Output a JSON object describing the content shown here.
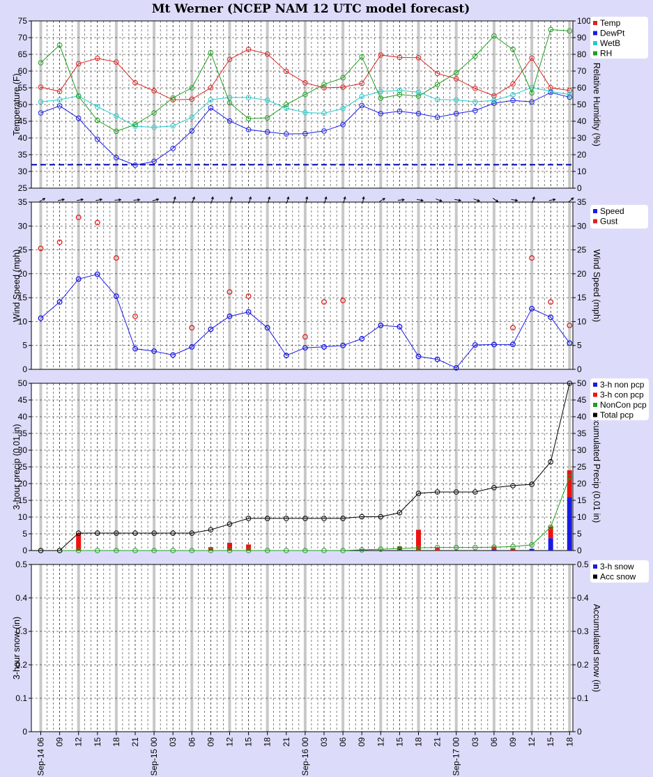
{
  "title": "Mt Werner (NCEP NAM 12 UTC model forecast)",
  "x_labels": [
    "Sep-14 06",
    "09",
    "12",
    "15",
    "18",
    "21",
    "Sep-15 00",
    "03",
    "06",
    "09",
    "12",
    "15",
    "18",
    "21",
    "Sep-16 00",
    "03",
    "06",
    "09",
    "12",
    "15",
    "18",
    "21",
    "Sep-17 00",
    "03",
    "06",
    "09",
    "12",
    "15",
    "18"
  ],
  "chart_data": [
    {
      "type": "line",
      "left_label": "Temperature (F)",
      "right_label": "Relative Humidity (%)",
      "ylim": [
        25,
        75
      ],
      "y_ticks": [
        25,
        30,
        35,
        40,
        45,
        50,
        55,
        60,
        65,
        70,
        75
      ],
      "y2lim": [
        0,
        100
      ],
      "y2_ticks": [
        0,
        10,
        20,
        30,
        40,
        50,
        60,
        70,
        80,
        90,
        100
      ],
      "legend": [
        {
          "name": "Temp",
          "color": "#dd2222"
        },
        {
          "name": "DewPt",
          "color": "#1a1ae6"
        },
        {
          "name": "WetB",
          "color": "#22cccc"
        },
        {
          "name": "RH",
          "color": "#1f9f1f"
        }
      ],
      "series": [
        {
          "name": "Temp",
          "color": "#dd2222",
          "axis": "left",
          "values": [
            55.2,
            53.9,
            62.2,
            63.8,
            62.7,
            56.5,
            54.1,
            51.4,
            51.6,
            55,
            63.5,
            66.5,
            65.1,
            59.9,
            56.5,
            55,
            55.2,
            56.3,
            64.8,
            64.1,
            64,
            59.3,
            57.7,
            54.8,
            52.6,
            56.1,
            63.9,
            55,
            54.2
          ]
        },
        {
          "name": "DewPt",
          "color": "#1a1ae6",
          "axis": "left",
          "values": [
            47.5,
            49.6,
            45.9,
            39.6,
            34.1,
            31.9,
            33,
            36.9,
            42.1,
            49,
            45.1,
            42.5,
            41.8,
            41.2,
            41.3,
            42.1,
            44,
            49.7,
            47.3,
            48,
            47.3,
            46.2,
            47.3,
            48.2,
            50.4,
            51.2,
            50.8,
            53.6,
            52.2
          ]
        },
        {
          "name": "WetB",
          "color": "#22cccc",
          "axis": "left",
          "values": [
            50.8,
            51.4,
            52.6,
            49.3,
            46.6,
            43.5,
            43.2,
            43.6,
            46.2,
            51.4,
            52.1,
            52.1,
            51.3,
            48.9,
            47.6,
            47.4,
            48.8,
            52.4,
            53.9,
            54.2,
            53.7,
            51.5,
            51.4,
            50.8,
            51.2,
            52.9,
            55.1,
            53.9,
            53
          ]
        },
        {
          "name": "RH",
          "color": "#1f9f1f",
          "axis": "right",
          "values": [
            75,
            85.5,
            55,
            40.5,
            34,
            38,
            45,
            54,
            60,
            81,
            51,
            41.6,
            42,
            50,
            56,
            62,
            66,
            78.5,
            53.7,
            56,
            55,
            62,
            69,
            79,
            91,
            83,
            57,
            94.8,
            94
          ]
        }
      ],
      "threshold_line": {
        "value": 32,
        "color": "#0000aa"
      }
    },
    {
      "type": "scatter",
      "left_label": "Wind Speed (mph)",
      "right_label": "Wind Speed (mph)",
      "ylim": [
        0,
        35
      ],
      "y_ticks": [
        0,
        5,
        10,
        15,
        20,
        25,
        30,
        35
      ],
      "legend": [
        {
          "name": "Speed",
          "color": "#1a1ae6"
        },
        {
          "name": "Gust",
          "color": "#dd2222"
        }
      ],
      "series": [
        {
          "name": "Speed",
          "color": "#1a1ae6",
          "values": [
            10.7,
            14.1,
            18.9,
            19.9,
            15.3,
            4.3,
            3.8,
            3,
            4.7,
            8.4,
            11.1,
            12,
            8.7,
            2.9,
            4.5,
            4.7,
            5,
            6.4,
            9.2,
            8.9,
            2.7,
            2.1,
            0.3,
            5.1,
            5.2,
            5.2,
            12.7,
            10.9,
            5.5
          ]
        },
        {
          "name": "Gust",
          "color": "#dd2222",
          "values": [
            25.3,
            26.6,
            31.8,
            30.7,
            23.3,
            11.1,
            null,
            null,
            8.7,
            null,
            16.2,
            15.3,
            null,
            null,
            6.8,
            14.1,
            14.4,
            null,
            null,
            null,
            null,
            null,
            null,
            null,
            null,
            8.7,
            23.3,
            14.1,
            9.2
          ]
        }
      ],
      "wind_dir_deg": [
        60,
        80,
        80,
        80,
        85,
        85,
        75,
        15,
        20,
        15,
        15,
        15,
        15,
        15,
        10,
        15,
        15,
        10,
        60,
        85,
        100,
        110,
        100,
        110,
        125,
        100,
        20,
        80,
        50
      ]
    },
    {
      "type": "bar",
      "left_label": "3-hour precip (0.01 in)",
      "right_label": "Accumulated Precip (0.01 in)",
      "ylim": [
        0,
        50
      ],
      "y_ticks": [
        0,
        5,
        10,
        15,
        20,
        25,
        30,
        35,
        40,
        45,
        50
      ],
      "legend": [
        {
          "name": "3-h non pcp",
          "color": "#1a1ae6"
        },
        {
          "name": "3-h con pcp",
          "color": "#ee1111"
        },
        {
          "name": "NonCon pcp",
          "color": "#1f9f1f"
        },
        {
          "name": "Total pcp",
          "color": "#000000"
        }
      ],
      "series": [
        {
          "name": "3-h non pcp",
          "color": "#1a1ae6",
          "values": [
            0,
            0,
            0,
            0,
            0,
            0,
            0,
            0,
            0,
            0,
            0,
            0,
            0,
            0,
            0,
            0,
            0,
            0.4,
            0,
            0.4,
            0,
            0,
            0,
            0,
            0.3,
            0,
            0.5,
            3.7,
            16
          ]
        },
        {
          "name": "3-h con pcp",
          "color": "#ee1111",
          "values": [
            0,
            0,
            5.2,
            0,
            0,
            0,
            0,
            0,
            0,
            1,
            2.3,
            1.8,
            0,
            0,
            0,
            0,
            0,
            0,
            0,
            0.8,
            6.2,
            0.8,
            0,
            0,
            0.9,
            0.6,
            0,
            3.5,
            8
          ]
        },
        {
          "name": "NonCon pcp",
          "color": "#1f9f1f",
          "values": [
            0,
            0,
            0,
            0,
            0,
            0,
            0,
            0,
            0,
            0,
            0,
            0,
            0,
            0,
            0,
            0,
            0,
            0.2,
            0.4,
            0.6,
            0.8,
            0.9,
            0.9,
            0.9,
            1,
            1.2,
            1.7,
            7,
            22
          ]
        },
        {
          "name": "Total pcp",
          "color": "#000000",
          "values": [
            0,
            0,
            5.2,
            5.2,
            5.2,
            5.2,
            5.2,
            5.2,
            5.2,
            6.2,
            7.9,
            9.6,
            9.6,
            9.6,
            9.6,
            9.6,
            9.6,
            10.1,
            10.1,
            11.3,
            17.1,
            17.5,
            17.5,
            17.5,
            18.8,
            19.4,
            19.8,
            26.5,
            50
          ]
        }
      ]
    },
    {
      "type": "bar",
      "left_label": "3-hour snow (in)",
      "right_label": "Accumulated snow (in)",
      "ylim": [
        0,
        0.5
      ],
      "y_ticks": [
        "0",
        "0.1",
        "0.2",
        "0.3",
        "0.4",
        "0.5"
      ],
      "legend": [
        {
          "name": "3-h snow",
          "color": "#1a1ae6"
        },
        {
          "name": "Acc snow",
          "color": "#000000"
        }
      ],
      "series": [
        {
          "name": "3-h snow",
          "color": "#1a1ae6",
          "values": [
            0,
            0,
            0,
            0,
            0,
            0,
            0,
            0,
            0,
            0,
            0,
            0,
            0,
            0,
            0,
            0,
            0,
            0,
            0,
            0,
            0,
            0,
            0,
            0,
            0,
            0,
            0,
            0,
            0
          ]
        },
        {
          "name": "Acc snow",
          "color": "#000000",
          "values": [
            0,
            0,
            0,
            0,
            0,
            0,
            0,
            0,
            0,
            0,
            0,
            0,
            0,
            0,
            0,
            0,
            0,
            0,
            0,
            0,
            0,
            0,
            0,
            0,
            0,
            0,
            0,
            0,
            0
          ]
        }
      ]
    }
  ]
}
